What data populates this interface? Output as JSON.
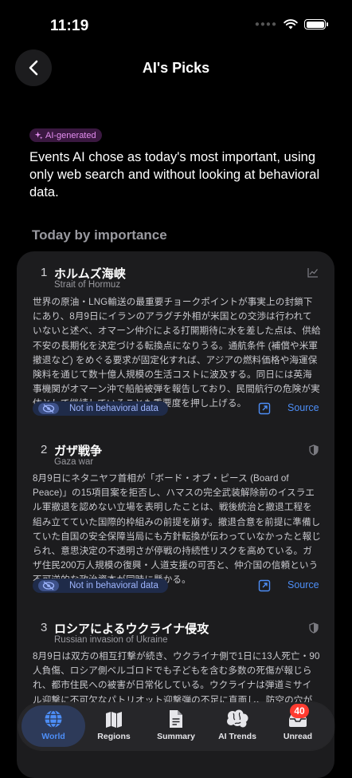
{
  "status": {
    "time": "11:19"
  },
  "nav": {
    "title": "AI's Picks"
  },
  "intro": {
    "badge": "AI-generated",
    "text": "Events AI chose as today's most important, using only web search and without looking at behavioral data."
  },
  "section_header": "Today by importance",
  "items": [
    {
      "rank": "1",
      "title": "ホルムズ海峡",
      "subtitle": "Strait of Hormuz",
      "body": "世界の原油・LNG輸送の最重要チョークポイントが事実上の封鎖下にあり、8月9日にイランのアラグチ外相が米国との交渉は行われていないと述べ、オマーン仲介による打開期待に水を差した点は、供給不安の長期化を決定づける転換点になりうる。通航条件 (補償や米軍撤退など) をめぐる要求が固定化すれば、アジアの燃料価格や海運保険料を通じて数十億人規模の生活コストに波及する。同日には英海事機関がオマーン沖で船舶被弾を報告しており、民間航行の危険が実体として継続していることも重要度を押し上げる。",
      "badge": "Not in behavioral data",
      "source": "Source",
      "icon": "trend-chart-icon"
    },
    {
      "rank": "2",
      "title": "ガザ戦争",
      "subtitle": "Gaza war",
      "body": "8月9日にネタニヤフ首相が「ボード・オブ・ピース (Board of Peace)」の15項目案を拒否し、ハマスの完全武装解除前のイスラエル軍撤退を認めない立場を表明したことは、戦後統治と撤退工程を組み立てていた国際的枠組みの前提を崩す。撤退合意を前提に準備していた自国の安全保障当局にも方針転換が伝わっていなかったと報じられ、意思決定の不透明さが停戦の持続性リスクを高めている。ガザ住民200万人規模の復興・人道支援の可否と、仲介国の信頼という不可逆的な政治資本が同時に懸かる。",
      "badge": "Not in behavioral data",
      "source": "Source",
      "icon": "half-shield-icon"
    },
    {
      "rank": "3",
      "title": "ロシアによるウクライナ侵攻",
      "subtitle": "Russian invasion of Ukraine",
      "body": "8月9日は双方の相互打撃が続き、ウクライナ側で1日に13人死亡・90人負傷、ロシア側ベルゴロドでも子どもを含む多数の死傷が報じられ、都市住民への被害が日常化している。ウクライナは弾道ミサイル迎撃に不可欠なパトリオット迎撃弾の不足に直面し、防空の穴が拡大する",
      "icon": "half-shield-icon"
    }
  ],
  "tabs": [
    {
      "label": "World",
      "icon": "globe-icon",
      "active": true
    },
    {
      "label": "Regions",
      "icon": "map-icon"
    },
    {
      "label": "Summary",
      "icon": "document-icon"
    },
    {
      "label": "AI Trends",
      "icon": "brain-icon"
    },
    {
      "label": "Unread",
      "icon": "inbox-icon",
      "badge": "40"
    }
  ],
  "colors": {
    "accent": "#4d8ef7",
    "ai_badge": "#e48ef0",
    "unread_badge": "#ff3b30"
  }
}
